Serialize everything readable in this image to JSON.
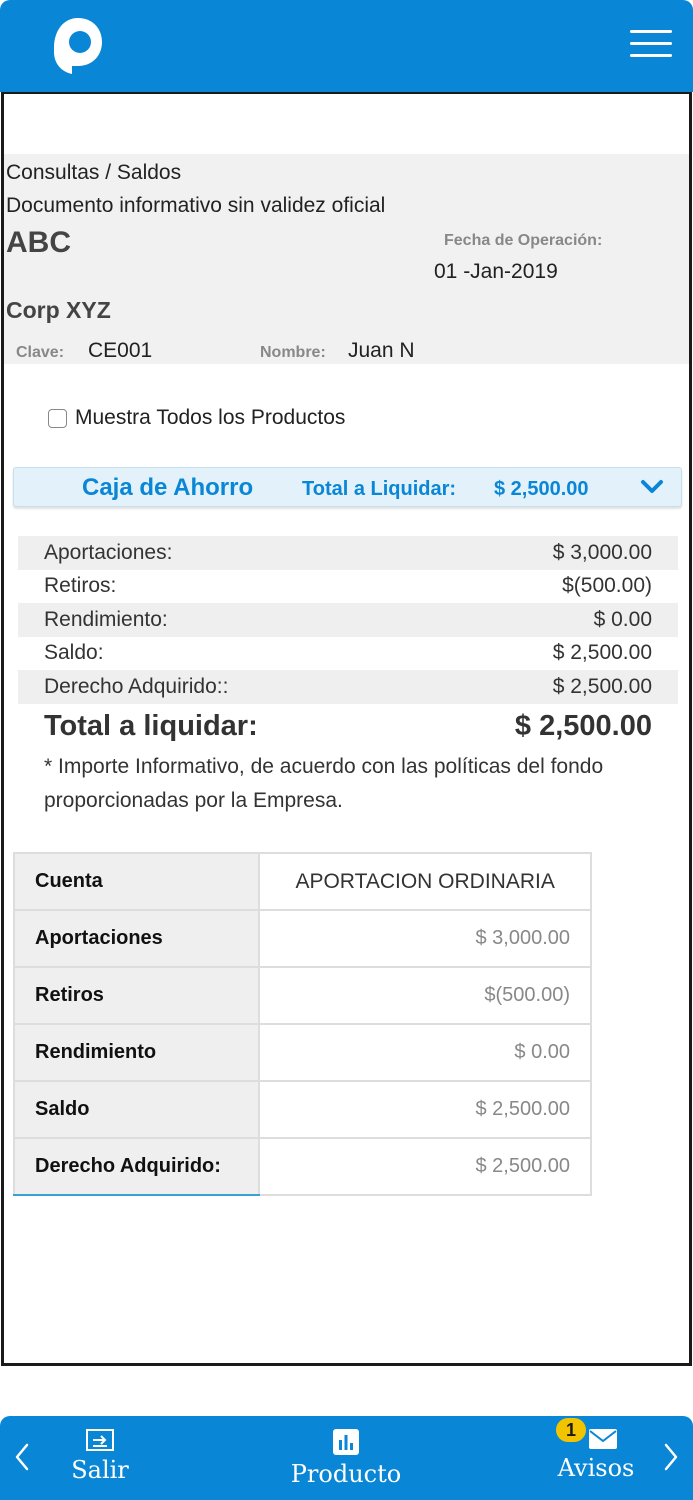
{
  "header": {
    "logo": "p-logo",
    "menu_icon": "hamburger-icon"
  },
  "info": {
    "breadcrumb": "Consultas / Saldos",
    "disclaimer": "Documento informativo sin validez oficial",
    "company_code": "ABC",
    "fecha_label": "Fecha de Operación:",
    "fecha_value": "01 -Jan-2019",
    "company_name": "Corp XYZ",
    "clave_label": "Clave:",
    "clave_value": "CE001",
    "nombre_label": "Nombre:",
    "nombre_value": "Juan N"
  },
  "show_all_label": "Muestra Todos los Productos",
  "product": {
    "title": "Caja de Ahorro",
    "total_label": "Total a Liquidar:",
    "total_amount": "$ 2,500.00"
  },
  "summary": [
    {
      "label": "Aportaciones:",
      "value": "$ 3,000.00"
    },
    {
      "label": "Retiros:",
      "value": "$(500.00)"
    },
    {
      "label": "Rendimiento:",
      "value": "$ 0.00"
    },
    {
      "label": "Saldo:",
      "value": "$ 2,500.00"
    },
    {
      "label": "Derecho Adquirido::",
      "value": "$ 2,500.00"
    }
  ],
  "total": {
    "label": "Total a liquidar:",
    "value": "$ 2,500.00"
  },
  "note": "* Importe Informativo, de acuerdo con las políticas del fondo proporcionadas por la Empresa.",
  "detail_table": {
    "header_label": "Cuenta",
    "header_value": "APORTACION ORDINARIA",
    "rows": [
      {
        "label": "Aportaciones",
        "value": "$ 3,000.00"
      },
      {
        "label": "Retiros",
        "value": "$(500.00)"
      },
      {
        "label": "Rendimiento",
        "value": "$ 0.00"
      },
      {
        "label": "Saldo",
        "value": "$ 2,500.00"
      },
      {
        "label": "Derecho Adquirido:",
        "value": "$ 2,500.00"
      }
    ]
  },
  "bottom_nav": {
    "salir": "Salir",
    "producto": "Producto",
    "avisos": "Avisos",
    "avisos_badge": "1"
  },
  "colors": {
    "brand": "#0a86d6",
    "panel": "#f1f1f1",
    "accordion_bg": "#e2f1fa",
    "badge": "#f2c400"
  }
}
